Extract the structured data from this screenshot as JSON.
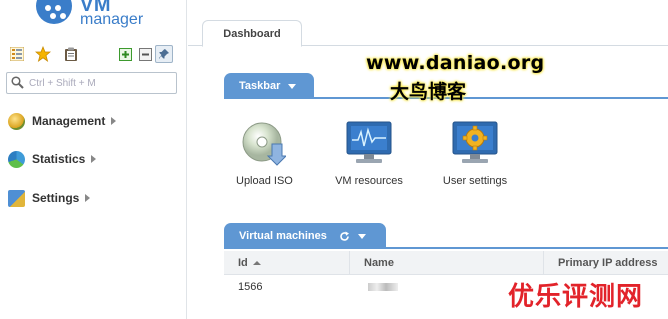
{
  "sidebar": {
    "logo": {
      "line1": "VM",
      "line2": "manager",
      "color": "#3a7dc9"
    },
    "toolbar": {
      "icons": [
        "tree-view-icon",
        "star-icon",
        "clipboard-icon",
        "expand-plus-icon",
        "collapse-minus-icon",
        "pin-icon"
      ]
    },
    "search": {
      "placeholder": "Ctrl + Shift + M",
      "value": ""
    },
    "nav": [
      {
        "label": "Management",
        "icon": "management-icon"
      },
      {
        "label": "Statistics",
        "icon": "statistics-pie-icon"
      },
      {
        "label": "Settings",
        "icon": "settings-icon"
      }
    ]
  },
  "main": {
    "tabs": [
      {
        "label": "Dashboard",
        "active": true
      }
    ],
    "taskbar": {
      "title": "Taskbar",
      "items": [
        {
          "label": "Upload ISO",
          "icon": "cd-upload-icon"
        },
        {
          "label": "VM resources",
          "icon": "monitor-graph-icon"
        },
        {
          "label": "User settings",
          "icon": "monitor-gear-icon"
        }
      ]
    },
    "vms": {
      "title": "Virtual machines",
      "columns": [
        "Id",
        "Name",
        "Primary IP address"
      ],
      "rows": [
        {
          "id": "1566",
          "name": "",
          "ip": ""
        }
      ]
    }
  },
  "watermarks": {
    "site": "www.daniao.org",
    "cn1": "大鸟博客",
    "cn2": "优乐评测网"
  },
  "colors": {
    "accent": "#5f97d3",
    "logo": "#3a7dc9",
    "watermark_red": "#e2232a"
  }
}
